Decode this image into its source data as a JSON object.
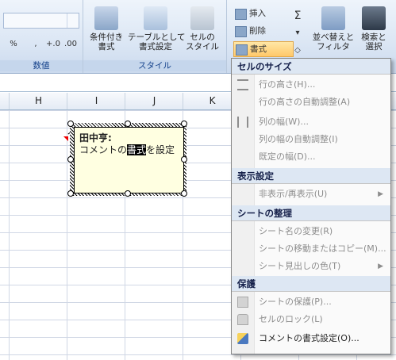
{
  "ribbon": {
    "number_group_label": "数値",
    "style_group_label": "スタイル",
    "conditional_format": "条件付き\n書式",
    "format_as_table": "テーブルとして\n書式設定",
    "cell_styles": "セルの\nスタイル",
    "insert": "挿入",
    "delete": "削除",
    "format": "書式",
    "sort_filter": "並べ替えと\nフィルタ",
    "find_select": "検索と\n選択",
    "percent": "%",
    "comma": ",",
    "sigma": "Σ"
  },
  "columns": [
    "H",
    "I",
    "J",
    "K"
  ],
  "comment": {
    "author": "田中亨:",
    "text_before": "コメントの",
    "text_selected": "書式",
    "text_after": "を設定"
  },
  "menu": {
    "section_cell_size": "セルのサイズ",
    "row_height": "行の高さ(H)...",
    "autofit_row": "行の高さの自動調整(A)",
    "col_width": "列の幅(W)...",
    "autofit_col": "列の幅の自動調整(I)",
    "default_width": "既定の幅(D)...",
    "section_visibility": "表示設定",
    "hide_unhide": "非表示/再表示(U)",
    "section_organize": "シートの整理",
    "rename_sheet": "シート名の変更(R)",
    "move_copy": "シートの移動またはコピー(M)...",
    "tab_color": "シート見出しの色(T)",
    "section_protection": "保護",
    "protect_sheet": "シートの保護(P)...",
    "lock_cell": "セルのロック(L)",
    "format_comment": "コメントの書式設定(O)..."
  }
}
